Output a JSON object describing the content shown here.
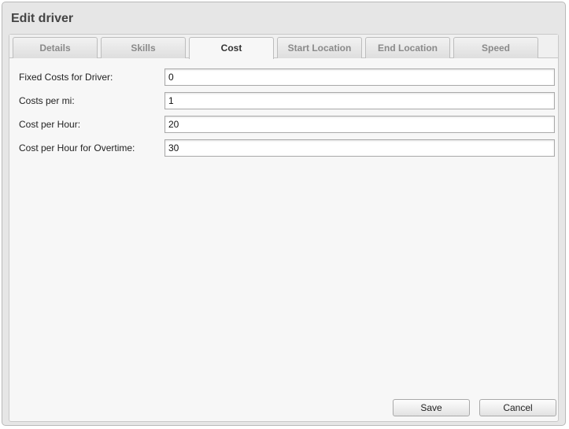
{
  "dialog": {
    "title": "Edit driver"
  },
  "tabs": [
    {
      "label": "Details",
      "active": false
    },
    {
      "label": "Skills",
      "active": false
    },
    {
      "label": "Cost",
      "active": true
    },
    {
      "label": "Start Location",
      "active": false
    },
    {
      "label": "End Location",
      "active": false
    },
    {
      "label": "Speed",
      "active": false
    }
  ],
  "form": {
    "fields": [
      {
        "label": "Fixed Costs for Driver:",
        "value": "0"
      },
      {
        "label": "Costs per mi:",
        "value": "1"
      },
      {
        "label": "Cost per Hour:",
        "value": "20"
      },
      {
        "label": "Cost per Hour for Overtime:",
        "value": "30"
      }
    ]
  },
  "buttons": {
    "save_label": "Save",
    "cancel_label": "Cancel"
  }
}
